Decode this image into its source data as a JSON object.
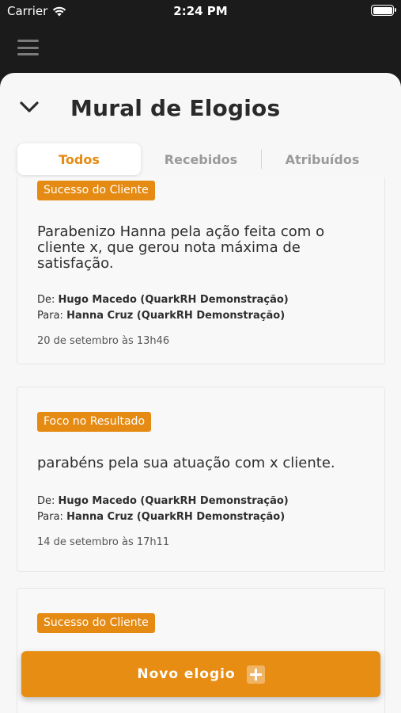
{
  "status_bar": {
    "carrier": "Carrier",
    "time": "2:24 PM"
  },
  "header": {
    "title": "Mural de Elogios"
  },
  "tabs": [
    {
      "label": "Todos",
      "active": true
    },
    {
      "label": "Recebidos",
      "active": false
    },
    {
      "label": "Atribuídos",
      "active": false
    }
  ],
  "cards": [
    {
      "badge": "Sucesso do Cliente",
      "message": "Parabenizo Hanna pela ação feita com o cliente x, que gerou nota máxima de satisfação.",
      "from_label": "De:",
      "from": "Hugo Macedo (QuarkRH Demonstração)",
      "to_label": "Para:",
      "to": "Hanna Cruz (QuarkRH Demonstração)",
      "date": "20 de setembro às 13h46"
    },
    {
      "badge": "Foco no Resultado",
      "message": "parabéns pela sua atuação com x cliente.",
      "from_label": "De:",
      "from": "Hugo Macedo (QuarkRH Demonstração)",
      "to_label": "Para:",
      "to": "Hanna Cruz (QuarkRH Demonstração)",
      "date": "14 de setembro às 17h11"
    },
    {
      "badge": "Sucesso do Cliente"
    }
  ],
  "cta": {
    "label": "Novo elogio"
  },
  "colors": {
    "accent": "#e58a12",
    "dark_bg": "#1b1b1b",
    "sheet_bg": "#f7f7f7"
  },
  "icons": [
    "wifi-icon",
    "battery-icon",
    "menu-icon",
    "chevron-down-icon",
    "plus-icon"
  ]
}
